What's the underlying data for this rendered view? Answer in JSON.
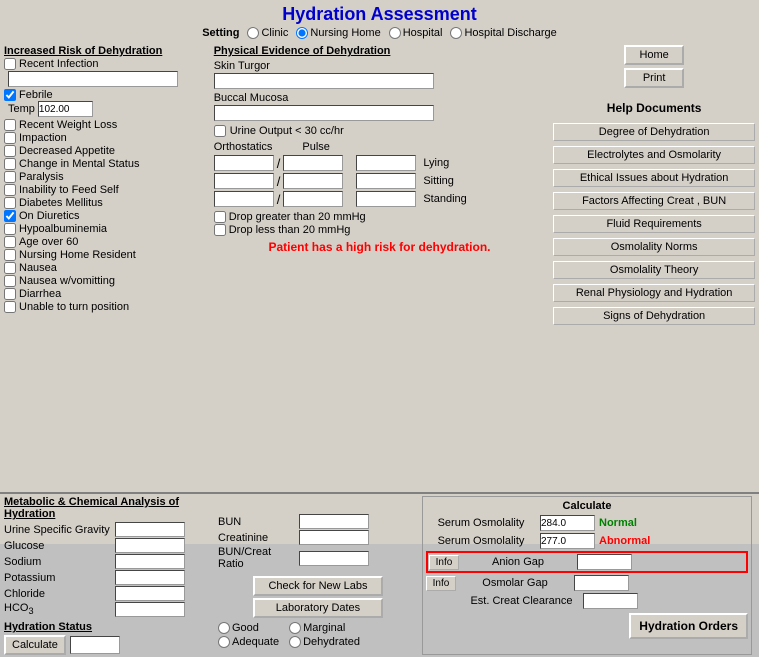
{
  "title": "Hydration Assessment",
  "setting": {
    "label": "Setting",
    "options": [
      {
        "label": "Clinic",
        "checked": false
      },
      {
        "label": "Nursing Home",
        "checked": true
      },
      {
        "label": "Hospital",
        "checked": false
      },
      {
        "label": "Hospital Discharge",
        "checked": false
      }
    ]
  },
  "left_section": {
    "title": "Increased Risk of Dehydration",
    "items": [
      {
        "label": "Recent Infection",
        "checked": false
      },
      {
        "label": "Febrile",
        "checked": true
      },
      {
        "label": "Recent Weight Loss",
        "checked": false
      },
      {
        "label": "Impaction",
        "checked": false
      },
      {
        "label": "Decreased Appetite",
        "checked": false
      },
      {
        "label": "Change in Mental Status",
        "checked": false
      },
      {
        "label": "Paralysis",
        "checked": false
      },
      {
        "label": "Inability to Feed Self",
        "checked": false
      },
      {
        "label": "Diabetes Mellitus",
        "checked": false
      },
      {
        "label": "On Diuretics",
        "checked": true
      },
      {
        "label": "Hypoalbuminemia",
        "checked": false
      },
      {
        "label": "Age over 60",
        "checked": false
      },
      {
        "label": "Nursing Home Resident",
        "checked": false
      },
      {
        "label": "Nausea",
        "checked": false
      },
      {
        "label": "Nausea w/vomitting",
        "checked": false
      },
      {
        "label": "Diarrhea",
        "checked": false
      },
      {
        "label": "Unable to turn position",
        "checked": false
      }
    ],
    "temp_label": "Temp",
    "temp_value": "102.00"
  },
  "middle_section": {
    "physical_title": "Physical Evidence of Dehydration",
    "skin_turgor": "Skin Turgor",
    "buccal_mucosa": "Buccal Mucosa",
    "urine_output": "Urine Output < 30 cc/hr",
    "orthostatics": "Orthostatics",
    "pulse": "Pulse",
    "lying": "Lying",
    "sitting": "Sitting",
    "standing": "Standing",
    "drop_greater": "Drop greater than 20 mmHg",
    "drop_less": "Drop less than 20 mmHg",
    "warning": "Patient has a high risk for dehydration."
  },
  "right_section": {
    "home_button": "Home",
    "print_button": "Print",
    "help_title": "Help Documents",
    "help_items": [
      "Degree of Dehydration",
      "Electrolytes and Osmolarity",
      "Ethical Issues about Hydration",
      "Factors Affecting Creat , BUN",
      "Fluid Requirements",
      "Osmolality Norms",
      "Osmolality Theory",
      "Renal Physiology and Hydration",
      "Signs of Dehydration"
    ]
  },
  "metabolic_section": {
    "title": "Metabolic & Chemical Analysis of Hydration",
    "labels": {
      "urine_sg": "Urine Specific Gravity",
      "glucose": "Glucose",
      "sodium": "Sodium",
      "potassium": "Potassium",
      "chloride": "Chloride",
      "hco3": "HCO",
      "bun": "BUN",
      "creatinine": "Creatinine",
      "bun_creat_ratio": "BUN/Creat Ratio"
    },
    "calculate_label": "Calculate",
    "serum_osmolality_label": "Serum Osmolality",
    "serum_osmolality_value1": "284.0",
    "serum_osmolality_status1": "Normal",
    "serum_osmolality_value2": "277.0",
    "serum_osmolality_status2": "Abnormal",
    "anion_gap_label": "Anion Gap",
    "osmolar_gap_label": "Osmolar Gap",
    "est_creat_label": "Est. Creat Clearance",
    "info_button": "Info",
    "check_labs_button": "Check for New Labs",
    "lab_dates_button": "Laboratory Dates"
  },
  "hydration_status": {
    "title": "Hydration Status",
    "calculate_button": "Calculate",
    "statuses": [
      {
        "label": "Good",
        "checked": false
      },
      {
        "label": "Marginal",
        "checked": false
      },
      {
        "label": "Adequate",
        "checked": false
      },
      {
        "label": "Dehydrated",
        "checked": false
      }
    ],
    "hydration_orders_button": "Hydration Orders"
  }
}
